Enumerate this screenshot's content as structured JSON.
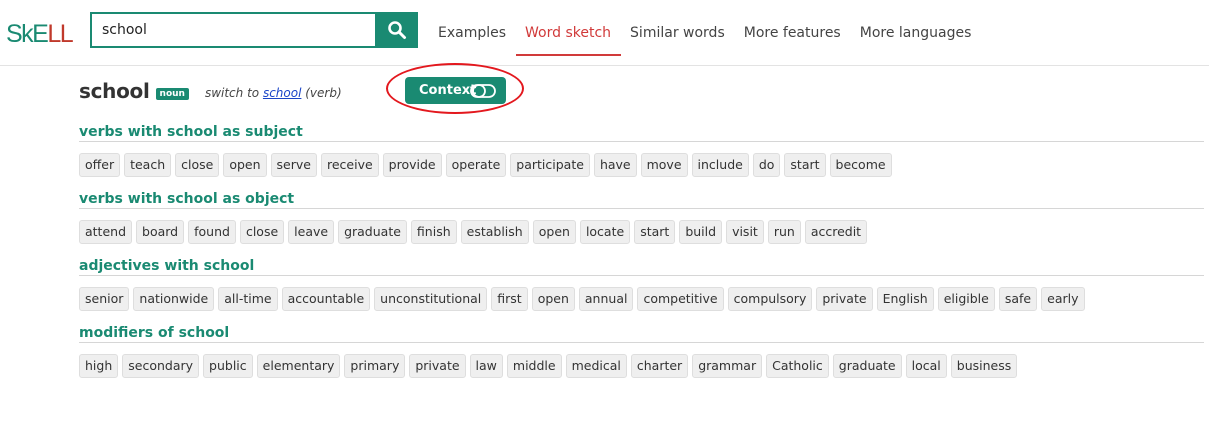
{
  "header": {
    "logo_sk": "SkE",
    "logo_ll": "LL",
    "search": {
      "value": "school",
      "placeholder": ""
    },
    "nav": [
      {
        "label": "Examples",
        "active": false
      },
      {
        "label": "Word sketch",
        "active": true
      },
      {
        "label": "Similar words",
        "active": false
      },
      {
        "label": "More features",
        "active": false
      },
      {
        "label": "More languages",
        "active": false
      }
    ]
  },
  "headword": {
    "word": "school",
    "pos": "noun",
    "switch_prefix": "switch to ",
    "switch_word": "school",
    "switch_suffix": " (verb)",
    "context_label": "Context"
  },
  "sections": [
    {
      "title": "verbs with school as subject",
      "items": [
        "offer",
        "teach",
        "close",
        "open",
        "serve",
        "receive",
        "provide",
        "operate",
        "participate",
        "have",
        "move",
        "include",
        "do",
        "start",
        "become"
      ]
    },
    {
      "title": "verbs with school as object",
      "items": [
        "attend",
        "board",
        "found",
        "close",
        "leave",
        "graduate",
        "finish",
        "establish",
        "open",
        "locate",
        "start",
        "build",
        "visit",
        "run",
        "accredit"
      ]
    },
    {
      "title": "adjectives with school",
      "items": [
        "senior",
        "nationwide",
        "all-time",
        "accountable",
        "unconstitutional",
        "first",
        "open",
        "annual",
        "competitive",
        "compulsory",
        "private",
        "English",
        "eligible",
        "safe",
        "early"
      ]
    },
    {
      "title": "modifiers of school",
      "items": [
        "high",
        "secondary",
        "public",
        "elementary",
        "primary",
        "private",
        "law",
        "middle",
        "medical",
        "charter",
        "grammar",
        "Catholic",
        "graduate",
        "local",
        "business"
      ]
    }
  ],
  "colors": {
    "accent": "#1a8a72",
    "active_nav": "#d13a3a",
    "annotation": "#e3181e"
  },
  "icons": {
    "search": "search-icon",
    "toggle": "toggle-icon"
  }
}
